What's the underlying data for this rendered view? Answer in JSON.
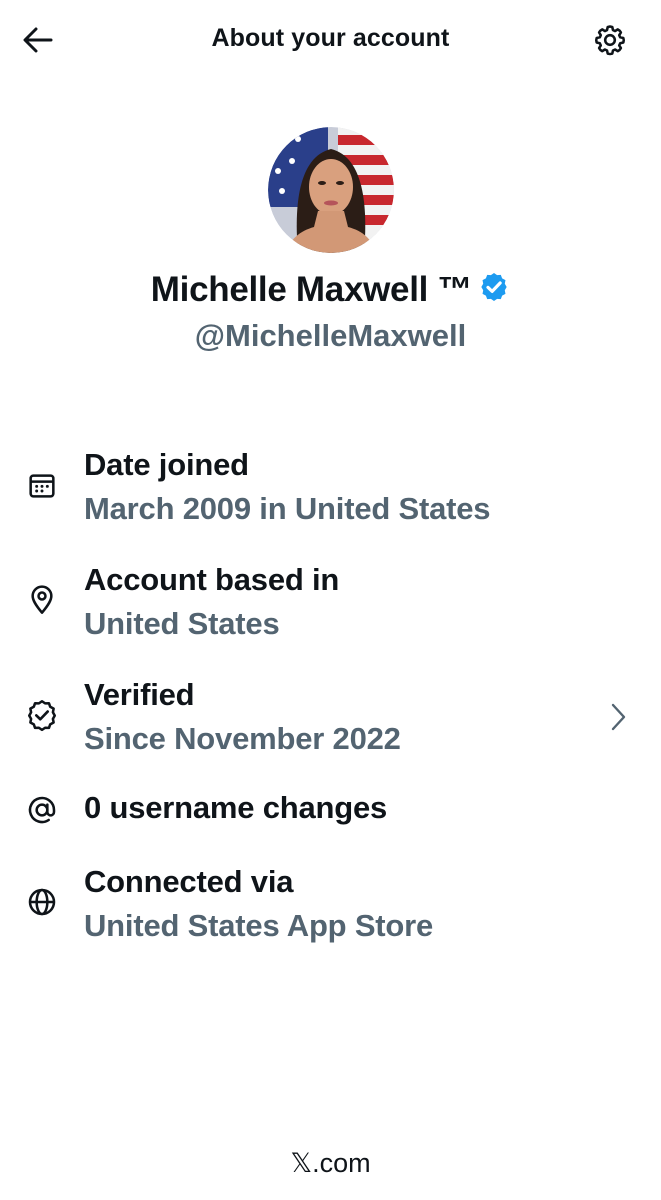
{
  "header": {
    "title": "About your account",
    "back_icon": "arrow-left-icon",
    "settings_icon": "gear-icon"
  },
  "profile": {
    "display_name": "Michelle Maxwell ™",
    "handle": "@MichelleMaxwell",
    "verified": true,
    "verified_color": "#1d9bf0",
    "avatar_description_icon": "avatar-image"
  },
  "rows": [
    {
      "icon": "calendar-icon",
      "title": "Date joined",
      "subtitle": "March 2009 in United States"
    },
    {
      "icon": "location-pin-icon",
      "title": "Account based in",
      "subtitle": "United States"
    },
    {
      "icon": "verified-check-icon",
      "title": "Verified",
      "subtitle": "Since November 2022"
    },
    {
      "icon": "at-sign-icon",
      "title": "0 username changes"
    },
    {
      "icon": "globe-icon",
      "title": "Connected via",
      "subtitle": "United States App Store"
    }
  ],
  "footer": {
    "text": "𝕏.com"
  },
  "colors": {
    "primary_text": "#0f1419",
    "secondary_text": "#536471",
    "accent": "#1d9bf0",
    "background": "#ffffff"
  }
}
